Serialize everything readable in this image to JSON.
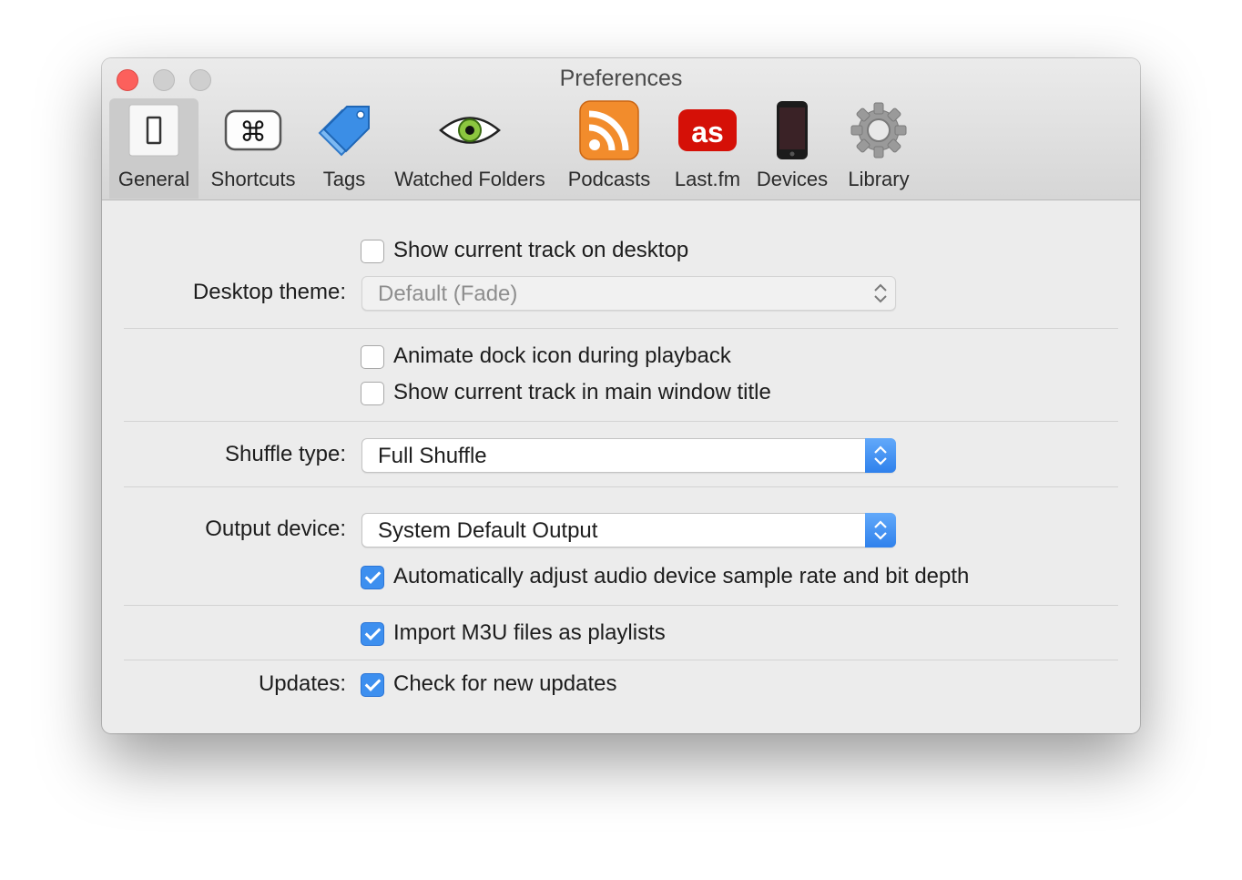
{
  "window": {
    "title": "Preferences"
  },
  "toolbar": {
    "tabs": [
      {
        "label": "General",
        "icon": "switch-icon",
        "selected": true
      },
      {
        "label": "Shortcuts",
        "icon": "command-key-icon"
      },
      {
        "label": "Tags",
        "icon": "tags-icon"
      },
      {
        "label": "Watched Folders",
        "icon": "eye-icon"
      },
      {
        "label": "Podcasts",
        "icon": "rss-icon"
      },
      {
        "label": "Last.fm",
        "icon": "lastfm-icon"
      },
      {
        "label": "Devices",
        "icon": "phone-icon"
      },
      {
        "label": "Library",
        "icon": "gear-icon"
      }
    ]
  },
  "general": {
    "show_track_desktop": {
      "label": "Show current track on desktop",
      "checked": false
    },
    "desktop_theme": {
      "label": "Desktop theme:",
      "value": "Default (Fade)",
      "enabled": false
    },
    "animate_dock": {
      "label": "Animate dock icon during playback",
      "checked": false
    },
    "show_track_title": {
      "label": "Show current track in main window title",
      "checked": false
    },
    "shuffle_type": {
      "label": "Shuffle type:",
      "value": "Full Shuffle"
    },
    "output_device": {
      "label": "Output device:",
      "value": "System Default Output"
    },
    "auto_adjust": {
      "label": "Automatically adjust audio device sample rate and bit depth",
      "checked": true
    },
    "import_m3u": {
      "label": "Import M3U files as playlists",
      "checked": true
    },
    "updates": {
      "label": "Updates:",
      "check_label": "Check for new updates",
      "checked": true
    }
  },
  "colors": {
    "accent": "#3d8fef",
    "close": "#fc605c",
    "rss": "#f28c2c",
    "lastfm": "#d51007"
  }
}
